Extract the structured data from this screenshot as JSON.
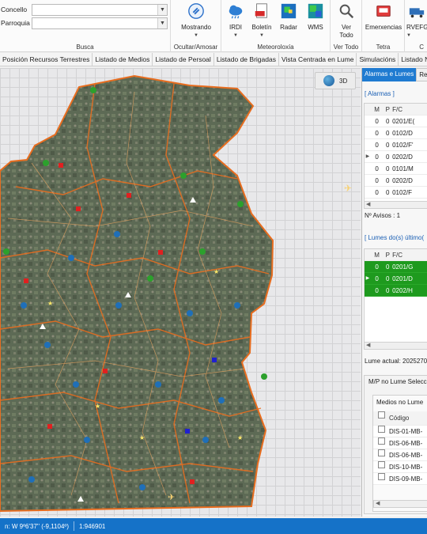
{
  "ribbon": {
    "busca": {
      "label": "Busca",
      "concello_label": "Concello",
      "parroquia_label": "Parroquia",
      "concello_value": "",
      "parroquia_value": ""
    },
    "ocultar": {
      "button_label": "Mostrando",
      "group_label": "Ocultar/Amosar"
    },
    "meteoroloxia": {
      "group_label": "Meteoroloxía",
      "irdi_label": "IRDI",
      "boletin_label": "Boletín",
      "radar_label": "Radar",
      "wms_label": "WMS"
    },
    "vertodo": {
      "button_label_1": "Ver",
      "button_label_2": "Todo",
      "group_label": "Ver Todo"
    },
    "tetra": {
      "button_label": "Emerxencias",
      "group_label": "Tetra"
    },
    "rvefg": {
      "button_label": "RVEFG",
      "group_label": "C"
    }
  },
  "tabs": [
    "Posición Recursos Terrestres",
    "Listado de Medios",
    "Listado de Persoal",
    "Listado de Brigadas",
    "Vista Centrada en Lume",
    "Simulacións",
    "Listado Notificac"
  ],
  "map": {
    "button_3d_label": "3D"
  },
  "panel": {
    "tab_active": "Alarmas e Lumes",
    "tab_inactive": "Re",
    "alarmas_section": "[ Alarmas ]",
    "alarmas_headers": {
      "m": "M",
      "p": "P",
      "fc": "F/C"
    },
    "alarmas_rows": [
      {
        "m": "0",
        "p": "0",
        "fc": "0201/E("
      },
      {
        "m": "0",
        "p": "0",
        "fc": "0102/D"
      },
      {
        "m": "0",
        "p": "0",
        "fc": "0102/F'"
      },
      {
        "m": "0",
        "p": "0",
        "fc": "0202/D"
      },
      {
        "m": "0",
        "p": "0",
        "fc": "0101/M"
      },
      {
        "m": "0",
        "p": "0",
        "fc": "0202/D"
      },
      {
        "m": "0",
        "p": "0",
        "fc": "0102/F"
      }
    ],
    "avisos_label": "Nº Avisos :",
    "avisos_value": "1",
    "lumes_section": "[ Lumes do(s) último(",
    "lumes_headers": {
      "m": "M",
      "p": "P",
      "fc": "F/C"
    },
    "lumes_rows": [
      {
        "m": "0",
        "p": "0",
        "fc": "0201/G"
      },
      {
        "m": "0",
        "p": "0",
        "fc": "0201/D"
      },
      {
        "m": "0",
        "p": "0",
        "fc": "0202/H"
      }
    ],
    "lume_actual_label": "Lume actual:",
    "lume_actual_value": "2025270",
    "mp_section": "M/P no Lume Selecc",
    "medios_label": "Medios no Lume",
    "codigo_header": "Código",
    "medios_rows": [
      "DIS-01-MB-",
      "DIS-06-MB-",
      "DIS-06-MB-",
      "DIS-10-MB-",
      "DIS-09-MB-"
    ]
  },
  "status": {
    "coords": "n: W 9º6'37'' (-9,1104º)",
    "scale": "1:946901"
  },
  "colors": {
    "accent": "#1f7bd1",
    "status_bar": "#1572c8",
    "fire_row": "#1e9a1e",
    "road": "#e86d1f"
  }
}
